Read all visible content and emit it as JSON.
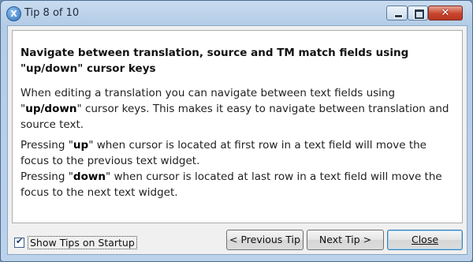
{
  "window": {
    "title": "Tip 8 of 10",
    "controls": {
      "minimize": "minimize",
      "maximize": "maximize",
      "close": "✕"
    }
  },
  "tip": {
    "heading": "Navigate between translation, source and TM match fields using \"up/down\" cursor keys",
    "p1": [
      "When editing a translation you can navigate between text fields using \"",
      "up/down",
      "\" cursor keys. This makes it easy to navigate between translation and source text."
    ],
    "p2": [
      "Pressing \"",
      "up",
      "\" when cursor is located at first row in a text field will move the focus to the previous text widget."
    ],
    "p3": [
      "Pressing \"",
      "down",
      "\" when cursor is located at last row in a text field will move the focus to the next text widget."
    ]
  },
  "footer": {
    "show_tips_label": "Show Tips on Startup",
    "show_tips_checked": true,
    "previous_label": "< Previous Tip",
    "next_label": "Next Tip >",
    "close_label": "Close"
  }
}
